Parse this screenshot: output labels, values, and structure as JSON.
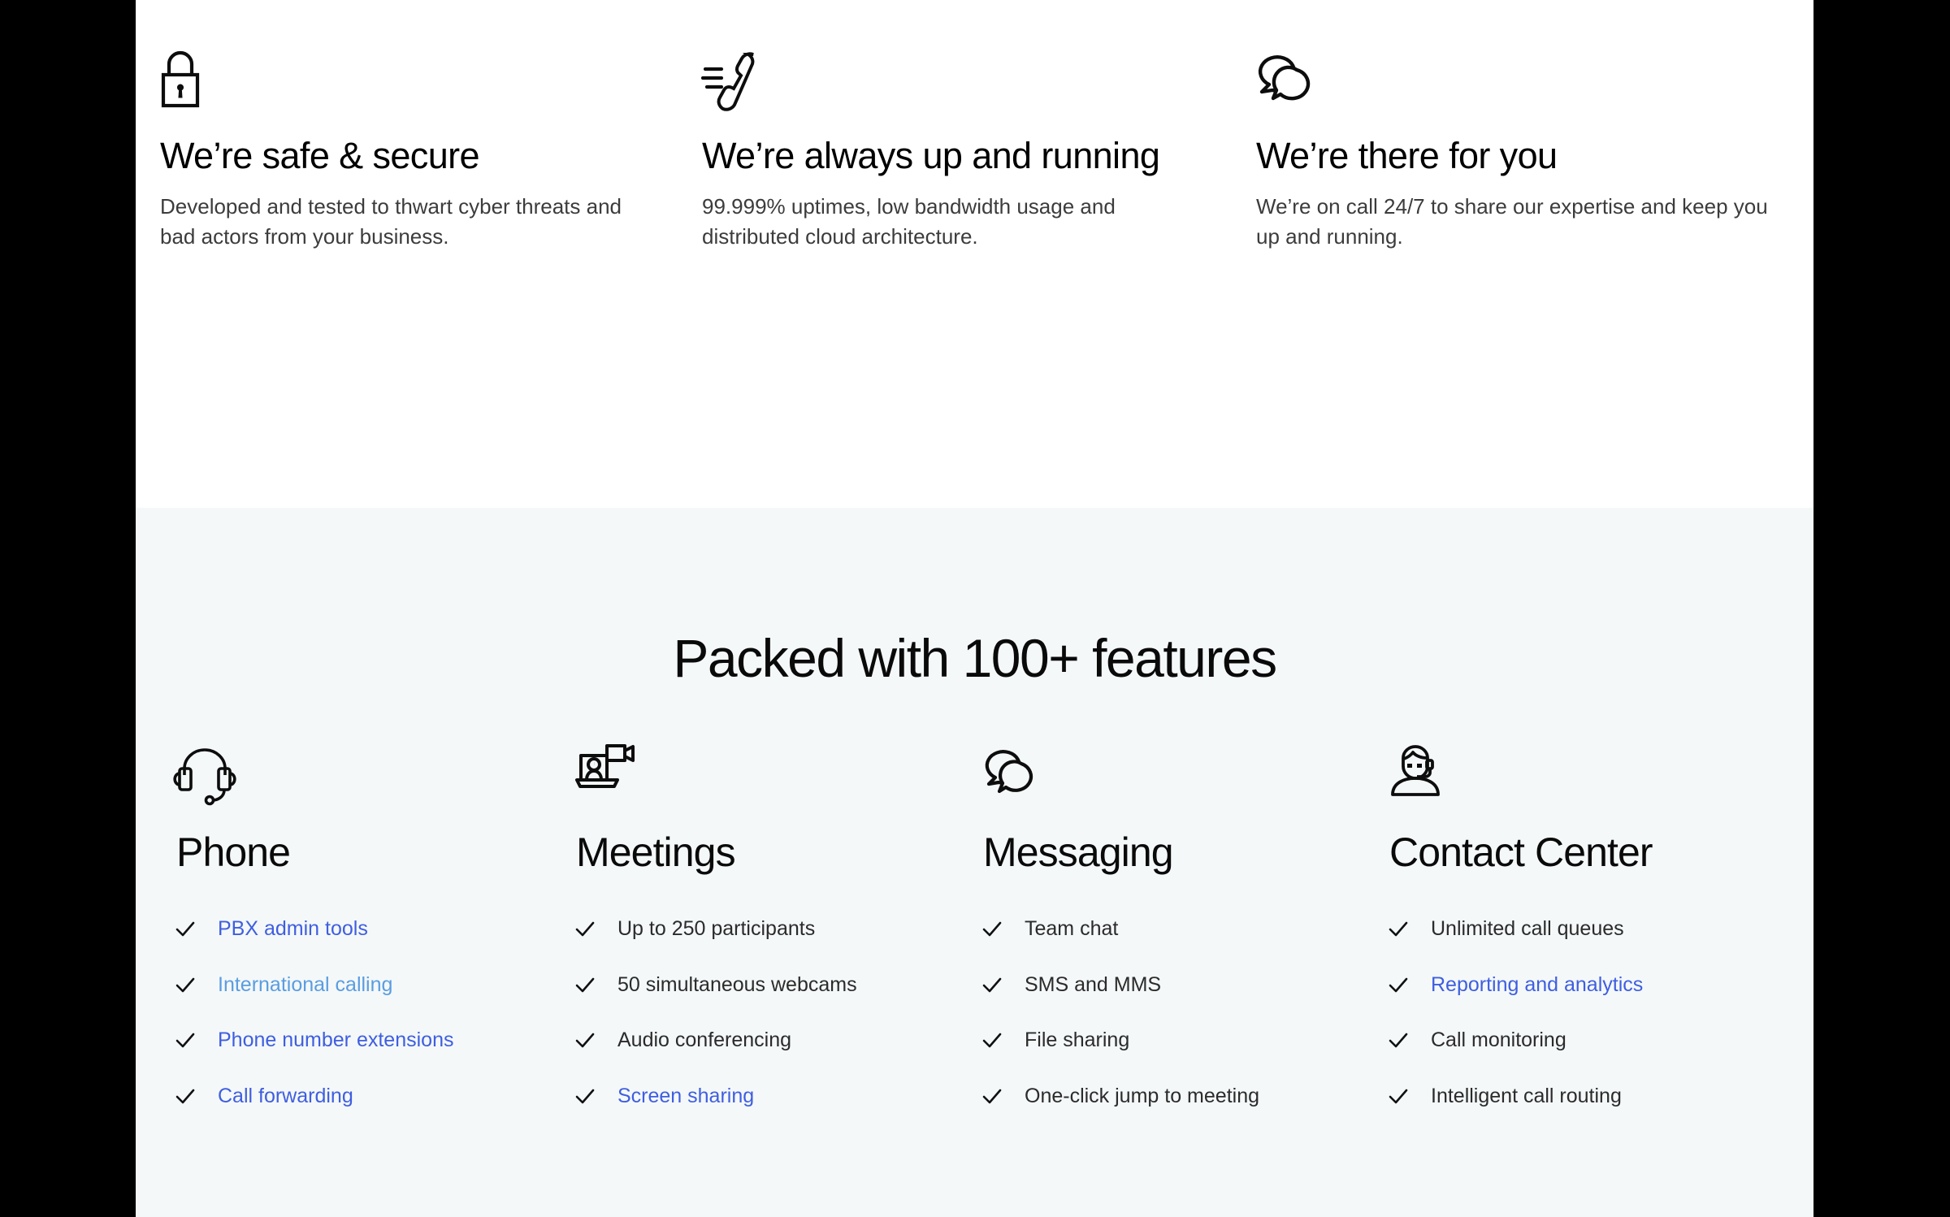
{
  "highlights": [
    {
      "icon": "lock-icon",
      "title": "We’re safe & secure",
      "description": "Developed and tested to thwart cyber threats and bad actors from your business."
    },
    {
      "icon": "ringing-phone-icon",
      "title": "We’re always up and running",
      "description": "99.999% uptimes, low bandwidth usage and distributed cloud architecture."
    },
    {
      "icon": "chat-bubbles-icon",
      "title": "We’re there for you",
      "description": "We’re on call 24/7 to share our expertise and keep you up and running."
    }
  ],
  "features_section": {
    "heading": "Packed with 100+ features",
    "columns": [
      {
        "icon": "headset-icon",
        "title": "Phone",
        "items": [
          {
            "label": "PBX admin tools",
            "style": "link"
          },
          {
            "label": "International calling",
            "style": "link-alt"
          },
          {
            "label": "Phone number extensions",
            "style": "link"
          },
          {
            "label": "Call forwarding",
            "style": "link"
          }
        ]
      },
      {
        "icon": "video-meeting-icon",
        "title": "Meetings",
        "items": [
          {
            "label": "Up to 250 participants",
            "style": "plain"
          },
          {
            "label": "50 simultaneous webcams",
            "style": "plain"
          },
          {
            "label": "Audio conferencing",
            "style": "plain"
          },
          {
            "label": "Screen sharing",
            "style": "link"
          }
        ]
      },
      {
        "icon": "message-bubbles-icon",
        "title": "Messaging",
        "items": [
          {
            "label": "Team chat",
            "style": "plain"
          },
          {
            "label": "SMS and MMS",
            "style": "plain"
          },
          {
            "label": "File sharing",
            "style": "plain"
          },
          {
            "label": "One-click jump to meeting",
            "style": "plain"
          }
        ]
      },
      {
        "icon": "agent-headset-icon",
        "title": "Contact Center",
        "items": [
          {
            "label": "Unlimited call queues",
            "style": "plain"
          },
          {
            "label": "Reporting and analytics",
            "style": "link"
          },
          {
            "label": "Call monitoring",
            "style": "plain"
          },
          {
            "label": "Intelligent call routing",
            "style": "plain"
          }
        ]
      }
    ]
  },
  "colors": {
    "page_top_background": "#ffffff",
    "page_bottom_background": "#f4f8f9",
    "heading_text": "#0a0a0a",
    "body_text": "#3c3c3c",
    "link": "#3f5ee0",
    "link_alt": "#5a9de0",
    "letterbox": "#000000"
  }
}
